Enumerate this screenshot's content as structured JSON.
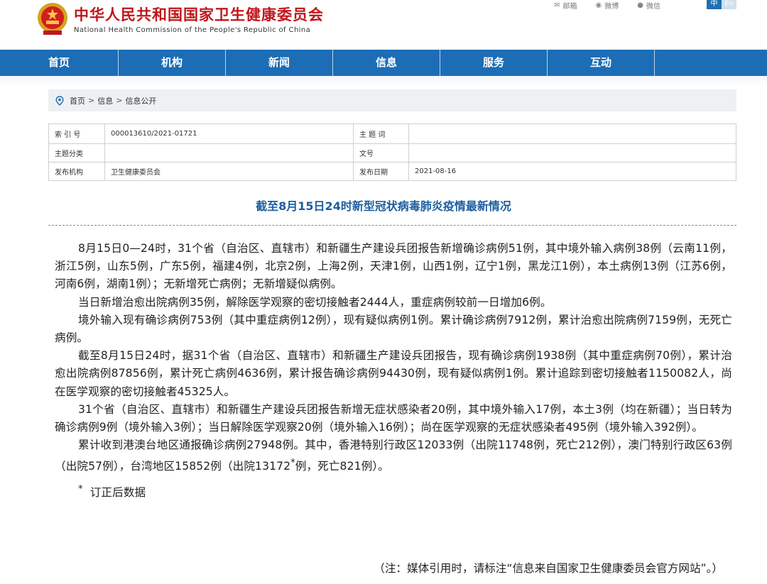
{
  "header": {
    "site_name_cn": "中华人民共和国国家卫生健康委员会",
    "site_name_en": "National Health Commission of the People's Republic of China",
    "toplinks": [
      {
        "label": "邮箱",
        "icon": "mail-icon"
      },
      {
        "label": "微博",
        "icon": "weibo-icon"
      },
      {
        "label": "微信",
        "icon": "wechat-icon"
      }
    ],
    "lang_cn": "中",
    "lang_en": "En"
  },
  "nav": [
    "首页",
    "机构",
    "新闻",
    "信息",
    "服务",
    "互动"
  ],
  "breadcrumb": {
    "items": [
      "首页",
      "信息",
      "信息公开"
    ],
    "separator": ">"
  },
  "meta": {
    "index_label": "索 引 号",
    "index_value": "000013610/2021-01721",
    "subject_word_label": "主 题 词",
    "subject_word_value": "",
    "subject_category_label": "主题分类",
    "subject_category_value": "",
    "doc_no_label": "文号",
    "doc_no_value": "",
    "publisher_label": "发布机构",
    "publisher_value": "卫生健康委员会",
    "date_label": "发布日期",
    "date_value": "2021-08-16"
  },
  "article": {
    "title": "截至8月15日24时新型冠状病毒肺炎疫情最新情况",
    "p1": "8月15日0—24时，31个省（自治区、直辖市）和新疆生产建设兵团报告新增确诊病例51例，其中境外输入病例38例（云南11例，浙江5例，山东5例，广东5例，福建4例，北京2例，上海2例，天津1例，山西1例，辽宁1例，黑龙江1例），本土病例13例（江苏6例，河南6例，湖南1例）；无新增死亡病例；无新增疑似病例。",
    "p2": "当日新增治愈出院病例35例，解除医学观察的密切接触者2444人，重症病例较前一日增加6例。",
    "p3": "境外输入现有确诊病例753例（其中重症病例12例），现有疑似病例1例。累计确诊病例7912例，累计治愈出院病例7159例，无死亡病例。",
    "p4": "截至8月15日24时，据31个省（自治区、直辖市）和新疆生产建设兵团报告，现有确诊病例1938例（其中重症病例70例），累计治愈出院病例87856例，累计死亡病例4636例，累计报告确诊病例94430例，现有疑似病例1例。累计追踪到密切接触者1150082人，尚在医学观察的密切接触者45325人。",
    "p5": "31个省（自治区、直辖市）和新疆生产建设兵团报告新增无症状感染者20例，其中境外输入17例，本土3例（均在新疆）；当日转为确诊病例9例（境外输入3例）；当日解除医学观察20例（境外输入16例）；尚在医学观察的无症状感染者495例（境外输入392例）。",
    "p6_a": "累计收到港澳台地区通报确诊病例27948例。其中，香港特别行政区12033例（出院11748例，死亡212例），澳门特别行政区63例（出院57例），台湾地区15852例（出院13172",
    "p6_star": "*",
    "p6_b": "例，死亡821例）。",
    "note_star": "*",
    "note_text": "订正后数据",
    "footer": "（注：媒体引用时，请标注“信息来自国家卫生健康委员会官方网站”。）"
  }
}
